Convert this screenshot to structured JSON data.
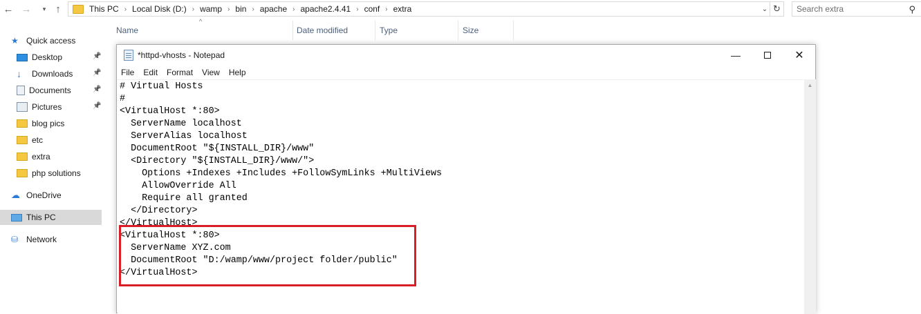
{
  "explorer": {
    "breadcrumbs": [
      "This PC",
      "Local Disk (D:)",
      "wamp",
      "bin",
      "apache",
      "apache2.4.41",
      "conf",
      "extra"
    ],
    "search_placeholder": "Search extra",
    "columns": [
      "Name",
      "Date modified",
      "Type",
      "Size"
    ],
    "sidebar": [
      {
        "label": "Quick access",
        "icon": "star-icon",
        "pinned": false
      },
      {
        "label": "Desktop",
        "icon": "desktop-icon",
        "pinned": true
      },
      {
        "label": "Downloads",
        "icon": "download-icon",
        "pinned": true
      },
      {
        "label": "Documents",
        "icon": "document-icon",
        "pinned": true
      },
      {
        "label": "Pictures",
        "icon": "pictures-icon",
        "pinned": true
      },
      {
        "label": "blog pics",
        "icon": "folder-icon",
        "pinned": false
      },
      {
        "label": "etc",
        "icon": "folder-icon",
        "pinned": false
      },
      {
        "label": "extra",
        "icon": "folder-icon",
        "pinned": false
      },
      {
        "label": "php solutions",
        "icon": "folder-icon",
        "pinned": false
      },
      {
        "label": "OneDrive",
        "icon": "cloud-icon",
        "pinned": false
      },
      {
        "label": "This PC",
        "icon": "computer-icon",
        "pinned": false,
        "selected": true
      },
      {
        "label": "Network",
        "icon": "network-icon",
        "pinned": false
      }
    ]
  },
  "notepad": {
    "title": "*httpd-vhosts - Notepad",
    "menu": [
      "File",
      "Edit",
      "Format",
      "View",
      "Help"
    ],
    "lines": [
      "# Virtual Hosts",
      "#",
      "<VirtualHost *:80>",
      "  ServerName localhost",
      "  ServerAlias localhost",
      "  DocumentRoot \"${INSTALL_DIR}/www\"",
      "  <Directory \"${INSTALL_DIR}/www/\">",
      "    Options +Indexes +Includes +FollowSymLinks +MultiViews",
      "    AllowOverride All",
      "    Require all granted",
      "  </Directory>",
      "</VirtualHost>",
      "<VirtualHost *:80>",
      "  ServerName XYZ.com",
      "  DocumentRoot \"D:/wamp/www/project folder/public\"",
      "</VirtualHost>"
    ]
  },
  "colors": {
    "highlight": "#d91e28",
    "selected_row": "#d9d9d9",
    "header_text": "#4c607a"
  }
}
